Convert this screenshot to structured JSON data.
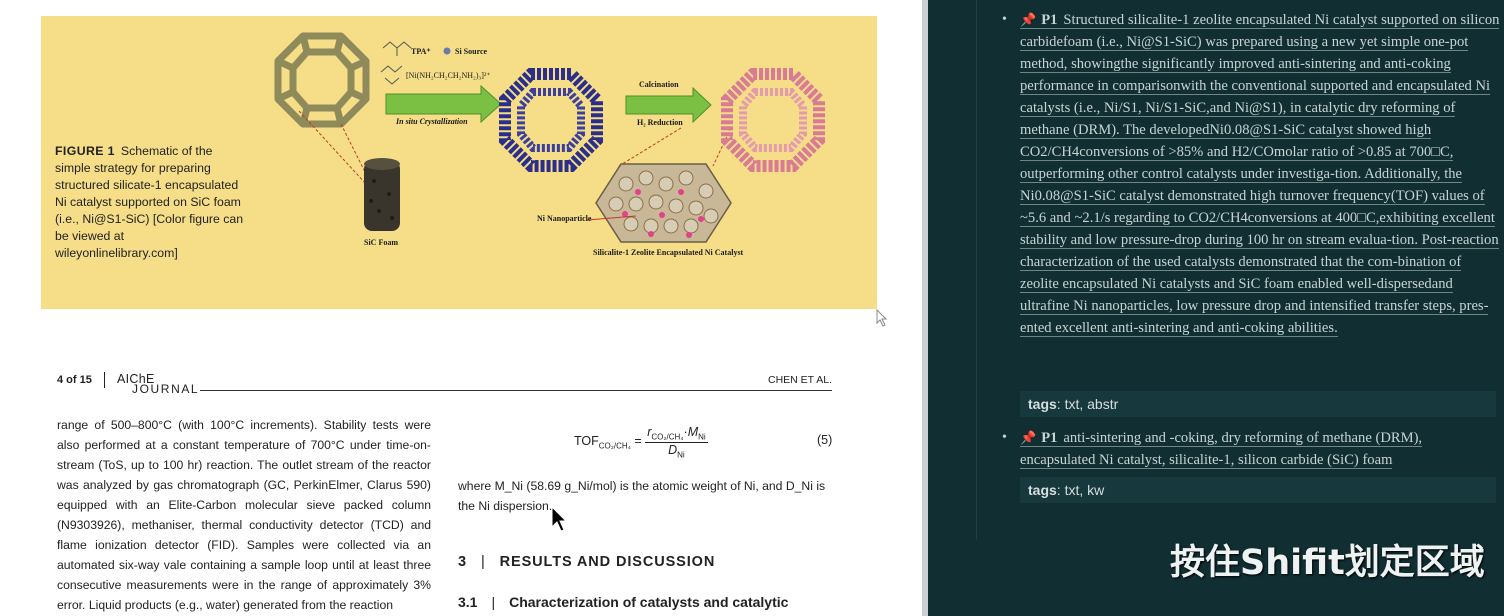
{
  "figure": {
    "caption_label": "FIGURE 1",
    "caption_text": "Schematic of the simple strategy for preparing structured silicate-1 encapsulated Ni catalyst supported on SiC foam (i.e., Ni@S1-SiC) [Color figure can be viewed at wileyonlinelibrary.com]",
    "labels": {
      "tpa": "TPA⁺",
      "si_source": "Si Source",
      "ni_complex": "[Ni(NH₂CH₂CH₂NH₂)₃]²⁺",
      "in_situ": "In situ Crystallization",
      "calcination": "Calcination",
      "h2_reduction": "H₂ Reduction",
      "sic_foam": "SiC Foam",
      "ni_nanoparticle": "Ni Nanoparticle",
      "catalyst": "Silicalite-1 Zeolite Encapsulated Ni Catalyst"
    },
    "background_color": "#f5de87"
  },
  "page_header": {
    "page_number": "4 of 15",
    "journal_line1": "AIChE",
    "journal_line2": "JOURNAL",
    "authors": "CHEN ET AL."
  },
  "body": {
    "left_column": "range of 500–800°C (with 100°C increments). Stability tests were also performed at a constant temperature of 700°C under time-on-stream (ToS, up to 100 hr) reaction. The outlet stream of the reactor was analyzed by gas chromatograph (GC, PerkinElmer, Clarus 590) equipped with an Elite-Carbon molecular sieve packed column (N9303926), methaniser, thermal conductivity detector (TCD) and flame ionization detector (FID). Samples were collected via an automated six-way vale containing a sample loop until at least three consecutive measurements were in the range of approximately 3% error. Liquid products (e.g., water) generated from the reaction",
    "equation_number": "(5)",
    "where_text": "where M_Ni (58.69 g_Ni/mol) is the atomic weight of Ni, and D_Ni is the Ni dispersion.",
    "section3_num": "3",
    "section3_title": "RESULTS AND DISCUSSION",
    "section31_num": "3.1",
    "section31_title": "Characterization of catalysts and catalytic"
  },
  "panel": {
    "notes": [
      {
        "marker": "P1",
        "text": "Structured silicalite-1 zeolite encapsulated Ni catalyst supported on silicon carbidefoam (i.e., Ni@S1-SiC) was prepared using a new yet simple one-pot method, showingthe significantly improved anti-sintering and anti-coking performance in comparisonwith the conventional supported and encapsulated Ni catalysts (i.e., Ni/S1, Ni/S1-SiC,and Ni@S1), in catalytic dry reforming of methane (DRM). The developedNi0.08@S1-SiC catalyst showed high CO2/CH4conversions of >85% and H2/COmolar ratio of >0.85 at 700□C, outperforming other control catalysts under investiga-tion. Additionally, the Ni0.08@S1-SiC catalyst demonstrated high turnover frequency(TOF) values of ~5.6 and ~2.1/s regarding to CO2/CH4conversions at 400□C,exhibiting excellent stability and low pressure-drop during 100 hr on stream evalua-tion. Post-reaction characterization of the used catalysts demonstrated that the com-bination of zeolite encapsulated Ni catalysts and SiC foam enabled well-dispersedand ultrafine Ni nanoparticles, low pressure drop and intensified transfer steps, pres-ented excellent anti-sintering and anti-coking abilities.",
        "tags_label": "tags",
        "tags_value": ": txt, abstr"
      },
      {
        "marker": "P1",
        "text": "anti-sintering and -coking, dry reforming of methane (DRM), encapsulated Ni catalyst, silicalite-1, silicon carbide (SiC) foam",
        "tags_label": "tags",
        "tags_value": ": txt, kw"
      }
    ],
    "overlay_text": "按住Shifit划定区域",
    "background_color": "#112f33",
    "pin_color": "#e04a3a"
  }
}
